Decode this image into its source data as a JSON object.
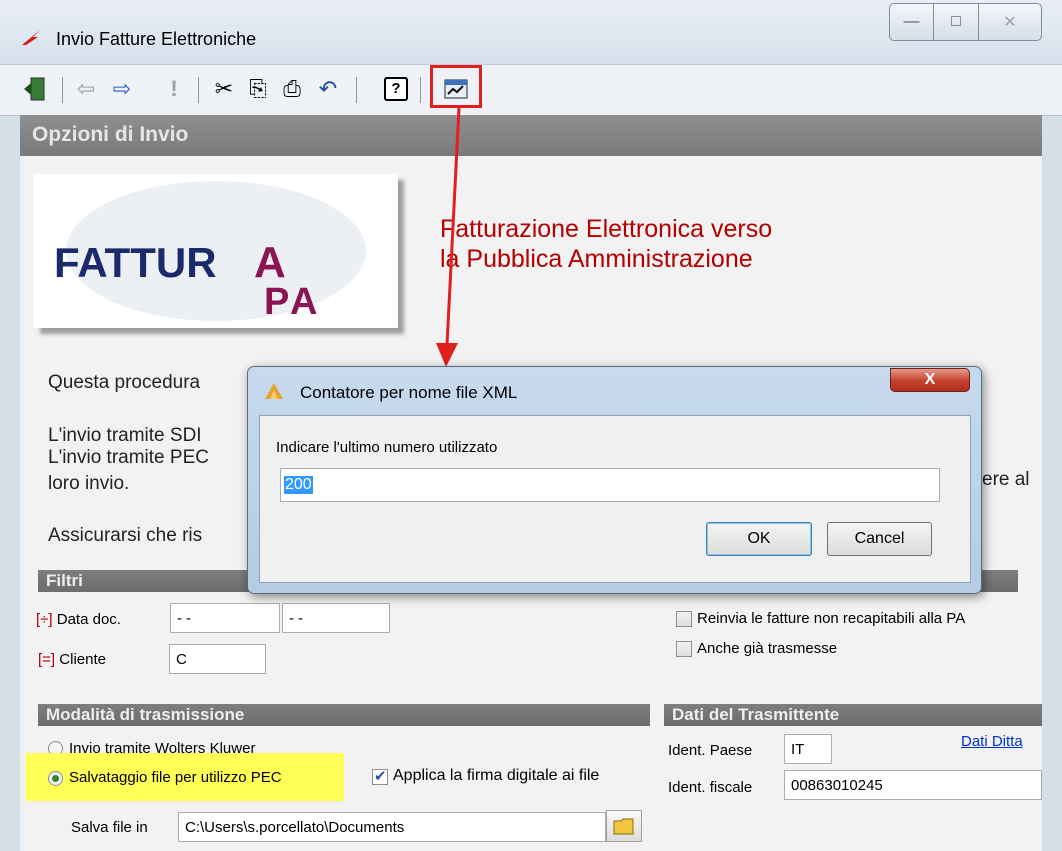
{
  "window": {
    "title": "Invio Fatture Elettroniche",
    "controls": {
      "minimize": "—",
      "maximize": "□",
      "close": "✕"
    }
  },
  "toolbar": {
    "exit_icon": "exit-door-icon",
    "back_glyph": "⇦",
    "forward_glyph": "⇨",
    "alert_glyph": "!",
    "cut_glyph": "✂",
    "copy_glyph": "⎘",
    "paste_glyph": "⎙",
    "undo_glyph": "↶",
    "help_glyph": "?",
    "counter_icon": "xml-counter-icon"
  },
  "section": {
    "title": "Opzioni di Invio"
  },
  "logo": {
    "text_main": "FATTUR",
    "text_a": "A",
    "text_p": "P",
    "text_a2": "A"
  },
  "heading": {
    "line1": "Fatturazione Elettronica verso",
    "line2": "la Pubblica Amministrazione"
  },
  "body_text": {
    "procedure": "Questa procedura",
    "sdi": "L'invio tramite SDI",
    "pec": "L'invio tramite PEC",
    "pec_end": "ere al",
    "pec_line2": "loro invio.",
    "assure": "Assicurarsi che ris"
  },
  "filters": {
    "title": "Filtri",
    "date_mark": "[÷]",
    "date_label": "Data doc.",
    "date_from": "- -",
    "date_to": "- -",
    "client_mark": "[=]",
    "client_label": "Cliente",
    "client_value": "C",
    "resend_label": "Reinvia le fatture non recapitabili alla PA",
    "already_label": "Anche già trasmesse"
  },
  "transmission": {
    "title": "Modalità di trasmissione",
    "option_wk": "Invio tramite Wolters Kluwer",
    "option_pec": "Salvataggio file per utilizzo PEC",
    "sign_label": "Applica la firma digitale ai file",
    "save_label": "Salva file in",
    "save_path": "C:\\Users\\s.porcellato\\Documents"
  },
  "sender": {
    "title": "Dati del Trasmittente",
    "company_link": "Dati Ditta",
    "country_label": "Ident. Paese",
    "country_value": "IT",
    "fiscal_label": "Ident. fiscale",
    "fiscal_value": "00863010245"
  },
  "dialog": {
    "title": "Contatore per nome file XML",
    "close": "X",
    "prompt": "Indicare l'ultimo numero utilizzato",
    "value": "200",
    "ok": "OK",
    "cancel": "Cancel"
  }
}
